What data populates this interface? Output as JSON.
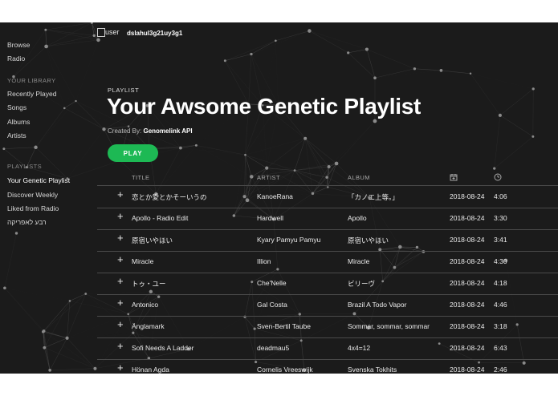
{
  "sidebar": {
    "top_items": [
      {
        "label": "Browse"
      },
      {
        "label": "Radio"
      }
    ],
    "library_heading": "YOUR LIBRARY",
    "library_items": [
      {
        "label": "Recently Played"
      },
      {
        "label": "Songs"
      },
      {
        "label": "Albums"
      },
      {
        "label": "Artists"
      }
    ],
    "playlists_heading": "PLAYLISTS",
    "playlist_items": [
      {
        "label": "Your Genetic Playlist"
      },
      {
        "label": "Discover Weekly"
      },
      {
        "label": "Liked from Radio"
      },
      {
        "label": "רבע לאפריקה"
      }
    ]
  },
  "header": {
    "user_label": "user",
    "user_id": "dslahul3g21uy3g1"
  },
  "playlist": {
    "kicker": "PLAYLIST",
    "title": "Your Awsome Genetic Playlist",
    "created_by_label": "Created By:",
    "created_by_name": "Genomelink API",
    "play_label": "PLAY"
  },
  "table": {
    "headers": {
      "title": "TITLE",
      "artist": "ARTIST",
      "album": "ALBUM",
      "date_icon": "calendar-icon",
      "duration_icon": "clock-icon"
    },
    "add_icon": "plus-icon",
    "rows": [
      {
        "add": "+",
        "title": "恋とか愛とかそーいうの",
        "artist": "KanoeRana",
        "album": "「カノエ上等。」",
        "date": "2018-08-24",
        "duration": "4:06"
      },
      {
        "add": "+",
        "title": "Apollo - Radio Edit",
        "artist": "Hardwell",
        "album": "Apollo",
        "date": "2018-08-24",
        "duration": "3:30"
      },
      {
        "add": "+",
        "title": "原宿いやほい",
        "artist": "Kyary Pamyu Pamyu",
        "album": "原宿いやほい",
        "date": "2018-08-24",
        "duration": "3:41"
      },
      {
        "add": "+",
        "title": "Miracle",
        "artist": "Illion",
        "album": "Miracle",
        "date": "2018-08-24",
        "duration": "4:30"
      },
      {
        "add": "+",
        "title": "トゥ・ユー",
        "artist": "Che'Nelle",
        "album": "ビリーヴ",
        "date": "2018-08-24",
        "duration": "4:18"
      },
      {
        "add": "+",
        "title": "Antonico",
        "artist": "Gal Costa",
        "album": "Brazil A Todo Vapor",
        "date": "2018-08-24",
        "duration": "4:46"
      },
      {
        "add": "+",
        "title": "Änglamark",
        "artist": "Sven-Bertil Taube",
        "album": "Sommar, sommar, sommar",
        "date": "2018-08-24",
        "duration": "3:18"
      },
      {
        "add": "+",
        "title": "Sofi Needs A Ladder",
        "artist": "deadmau5",
        "album": "4x4=12",
        "date": "2018-08-24",
        "duration": "6:43"
      },
      {
        "add": "+",
        "title": "Hönan Agda",
        "artist": "Cornelis Vreeswijk",
        "album": "Svenska Tokhits",
        "date": "2018-08-24",
        "duration": "2:46"
      }
    ]
  },
  "colors": {
    "background": "#1b1b1b",
    "accent": "#1db954"
  }
}
